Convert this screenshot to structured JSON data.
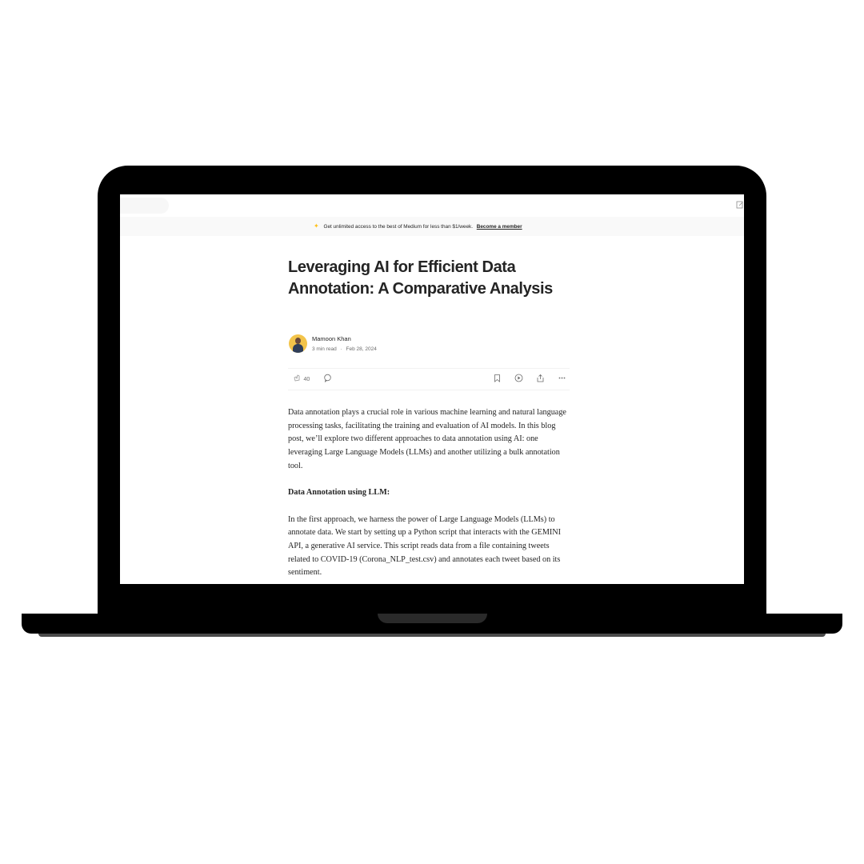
{
  "banner": {
    "icon": "sparkle-icon",
    "text": "Get unlimited access to the best of Medium for less than $1/week.",
    "link": "Become a member"
  },
  "article": {
    "title": "Leveraging AI for Efficient Data Annotation: A Comparative Analysis",
    "author": "Mamoon Khan",
    "read_time": "3 min read",
    "separator": "·",
    "date": "Feb 28, 2024",
    "claps": "40",
    "paragraphs": [
      "Data annotation plays a crucial role in various machine learning and natural language processing tasks, facilitating the training and evaluation of AI models. In this blog post, we’ll explore two different approaches to data annotation using AI: one leveraging Large Language Models (LLMs) and another utilizing a bulk annotation tool.",
      "Data Annotation using LLM:",
      "In the first approach, we harness the power of Large Language Models (LLMs) to annotate data. We start by setting up a Python script that interacts with the GEMINI API, a generative AI service. This script reads data from a file containing tweets related to COVID-19 (Corona_NLP_test.csv) and annotates each tweet based on its sentiment."
    ]
  },
  "icons": {
    "clap": "clap-icon",
    "comment": "comment-icon",
    "save": "bookmark-icon",
    "listen": "play-icon",
    "share": "share-icon",
    "more": "more-icon",
    "write": "write-icon"
  },
  "colors": {
    "accent": "#ffc017",
    "text": "#242424",
    "muted": "#6b6b6b"
  }
}
